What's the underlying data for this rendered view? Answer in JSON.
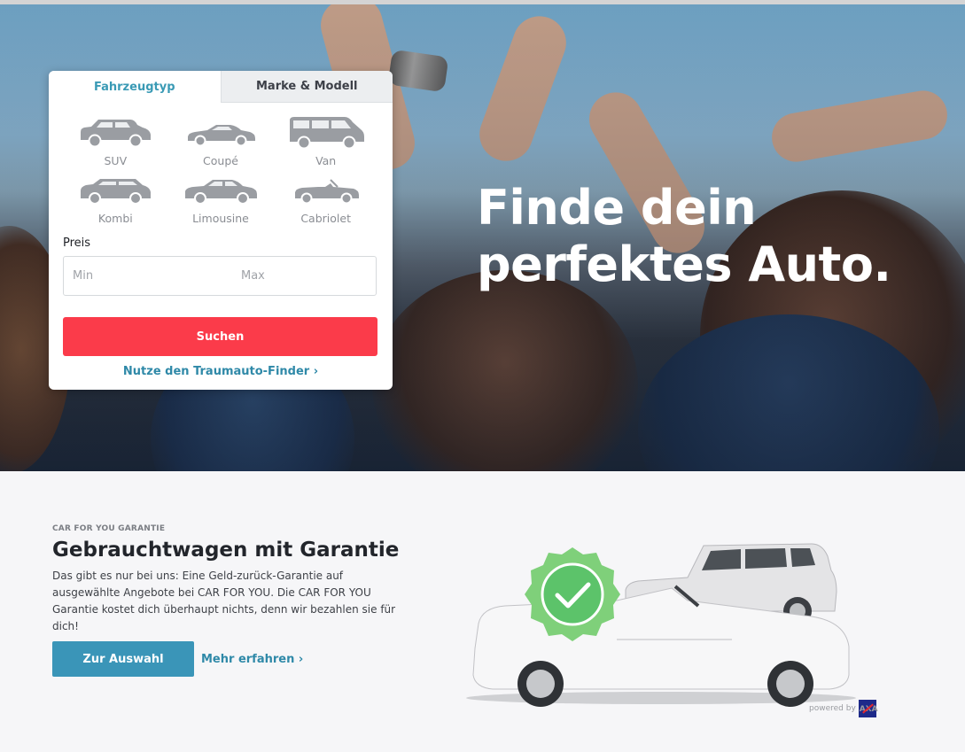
{
  "hero": {
    "headline_line1": "Finde dein",
    "headline_line2": "perfektes Auto."
  },
  "search": {
    "tabs": [
      {
        "label": "Fahrzeugtyp",
        "active": true
      },
      {
        "label": "Marke & Modell",
        "active": false
      }
    ],
    "vehicle_types": [
      {
        "label": "SUV",
        "icon": "suv-icon"
      },
      {
        "label": "Coupé",
        "icon": "coupe-icon"
      },
      {
        "label": "Van",
        "icon": "van-icon"
      },
      {
        "label": "Kombi",
        "icon": "kombi-icon"
      },
      {
        "label": "Limousine",
        "icon": "limousine-icon"
      },
      {
        "label": "Cabriolet",
        "icon": "cabriolet-icon"
      }
    ],
    "price_label": "Preis",
    "min_placeholder": "Min",
    "max_placeholder": "Max",
    "submit_label": "Suchen",
    "finder_link": "Nutze den Traumauto-Finder"
  },
  "guarantee": {
    "kicker": "CAR FOR YOU GARANTIE",
    "title": "Gebrauchtwagen mit Garantie",
    "text": "Das gibt es nur bei uns: Eine Geld-zurück-Garantie auf ausgewählte Angebote bei CAR FOR YOU. Die CAR FOR YOU Garantie kostet dich überhaupt nichts, denn wir bezahlen sie für dich!",
    "primary_button": "Zur Auswahl",
    "secondary_link": "Mehr erfahren",
    "powered_by": "powered by",
    "partner_logo": "AXA"
  },
  "colors": {
    "accent": "#3a95b8",
    "link": "#2f89a8",
    "search_button": "#fb3b4a",
    "badge_green": "#5cc36a"
  }
}
